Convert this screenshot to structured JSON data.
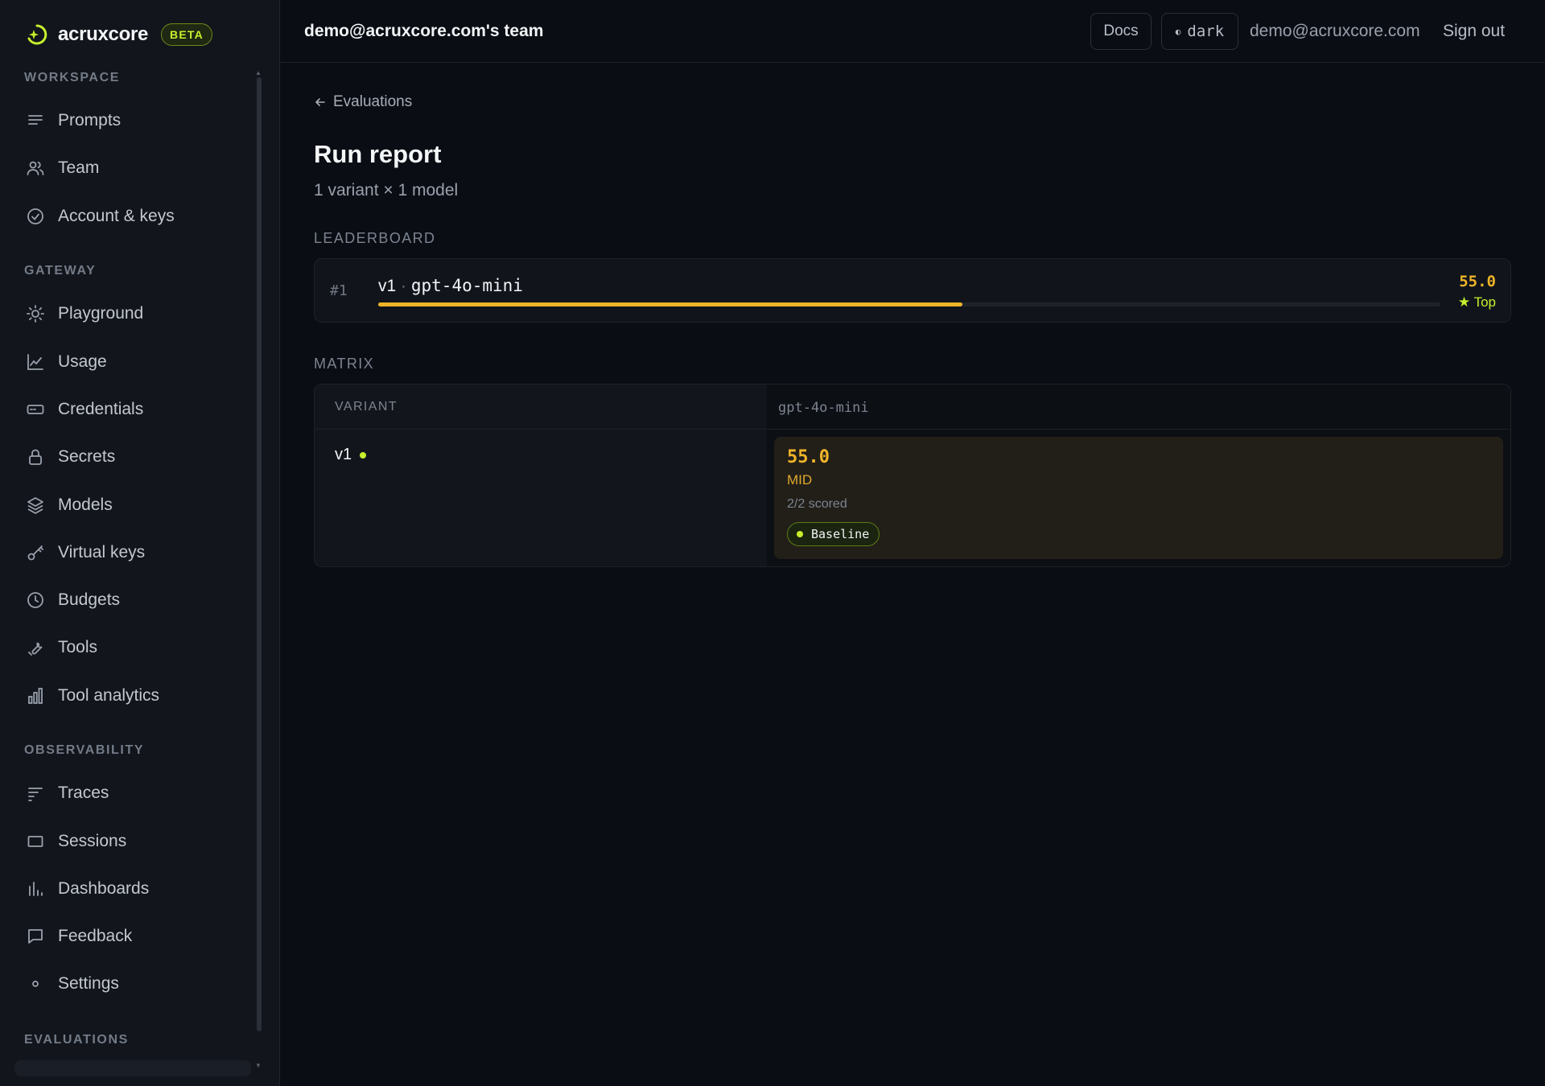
{
  "brand": {
    "name": "acruxcore",
    "badge": "BETA"
  },
  "sidebar": {
    "sections": [
      {
        "label": "WORKSPACE",
        "items": [
          {
            "label": "Prompts",
            "icon": "lines-icon"
          },
          {
            "label": "Team",
            "icon": "users-icon"
          },
          {
            "label": "Account & keys",
            "icon": "check-circle-icon"
          }
        ]
      },
      {
        "label": "GATEWAY",
        "items": [
          {
            "label": "Playground",
            "icon": "sun-icon"
          },
          {
            "label": "Usage",
            "icon": "line-chart-icon"
          },
          {
            "label": "Credentials",
            "icon": "card-icon"
          },
          {
            "label": "Secrets",
            "icon": "lock-icon"
          },
          {
            "label": "Models",
            "icon": "layers-icon"
          },
          {
            "label": "Virtual keys",
            "icon": "key-icon"
          },
          {
            "label": "Budgets",
            "icon": "clock-icon"
          },
          {
            "label": "Tools",
            "icon": "wrench-icon"
          },
          {
            "label": "Tool analytics",
            "icon": "bar-chart-icon"
          }
        ]
      },
      {
        "label": "OBSERVABILITY",
        "items": [
          {
            "label": "Traces",
            "icon": "traces-icon"
          },
          {
            "label": "Sessions",
            "icon": "square-icon"
          },
          {
            "label": "Dashboards",
            "icon": "bars-icon"
          },
          {
            "label": "Feedback",
            "icon": "message-icon"
          },
          {
            "label": "Settings",
            "icon": "dot-icon"
          }
        ]
      },
      {
        "label": "EVALUATIONS",
        "items": []
      }
    ]
  },
  "header": {
    "team": "demo@acruxcore.com's team",
    "docs": "Docs",
    "theme_glyph": "◐",
    "theme": "dark",
    "user_email": "demo@acruxcore.com",
    "sign_out": "Sign out"
  },
  "main": {
    "back_label": "Evaluations",
    "title": "Run report",
    "subtitle": "1 variant × 1 model",
    "leaderboard_label": "LEADERBOARD",
    "matrix_label": "MATRIX"
  },
  "leaderboard": [
    {
      "rank": "#1",
      "variant": "v1",
      "separator": "·",
      "model": "gpt-4o-mini",
      "score": "55.0",
      "score_fraction": 0.55,
      "top_label": "★ Top"
    }
  ],
  "matrix": {
    "col_variant": "VARIANT",
    "col_model": "gpt-4o-mini",
    "rows": [
      {
        "variant": "v1",
        "score": "55.0",
        "band": "MID",
        "scored": "2/2 scored",
        "badge": "Baseline"
      }
    ]
  },
  "colors": {
    "accent": "#c6f02c",
    "score": "#f0b429",
    "background": "#0a0d14",
    "sidebar": "#12151c"
  }
}
